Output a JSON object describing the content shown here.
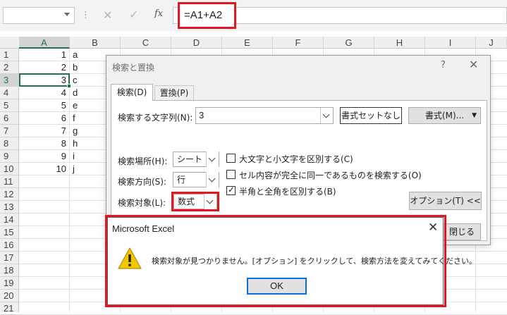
{
  "formula_bar": {
    "name_box": "",
    "cancel_icon": "✕",
    "enter_icon": "✓",
    "fx_label": "fx",
    "formula": "=A1+A2"
  },
  "grid": {
    "columns": [
      "A",
      "B",
      "C",
      "D",
      "E",
      "F",
      "G",
      "H",
      "I",
      "J"
    ],
    "rows": [
      "1",
      "2",
      "3",
      "4",
      "5",
      "6",
      "7",
      "8",
      "9",
      "10",
      "11",
      "12",
      "13",
      "14",
      "15",
      "16",
      "17",
      "18",
      "19",
      "20",
      "21"
    ],
    "col_a": [
      "1",
      "2",
      "3",
      "4",
      "5",
      "6",
      "7",
      "8",
      "9",
      "10"
    ],
    "col_b": [
      "a",
      "b",
      "c",
      "d",
      "e",
      "f",
      "g",
      "h",
      "i",
      "j"
    ],
    "selected_cell": "A3"
  },
  "find_replace": {
    "title": "検索と置換",
    "help": "?",
    "close": "✕",
    "tabs": [
      {
        "label": "検索(D)",
        "active": true
      },
      {
        "label": "置換(P)",
        "active": false
      }
    ],
    "find_what_label": "検索する文字列(N):",
    "find_what_value": "3",
    "no_format_button": "書式セットなし",
    "format_button": "書式(M)...",
    "within_label": "検索場所(H):",
    "within_value": "シート",
    "search_label": "検索方向(S):",
    "search_value": "行",
    "look_in_label": "検索対象(L):",
    "look_in_value": "数式",
    "options": [
      {
        "label": "大文字と小文字を区別する(C)",
        "checked": false
      },
      {
        "label": "セル内容が完全に同一であるものを検索する(O)",
        "checked": false
      },
      {
        "label": "半角と全角を区別する(B)",
        "checked": true
      }
    ],
    "options_button": "オプション(T) <<",
    "close_button": "閉じる"
  },
  "message_box": {
    "title": "Microsoft Excel",
    "close": "✕",
    "icon": "warning-icon",
    "message": "検索対象が見つかりません。[オプション] をクリックして、検索方法を変えてみてください。",
    "ok_button": "OK"
  },
  "colors": {
    "highlight": "#e8141f",
    "excel_green": "#217346",
    "focus_blue": "#0a6fd6",
    "warning_yellow": "#f6c600"
  }
}
